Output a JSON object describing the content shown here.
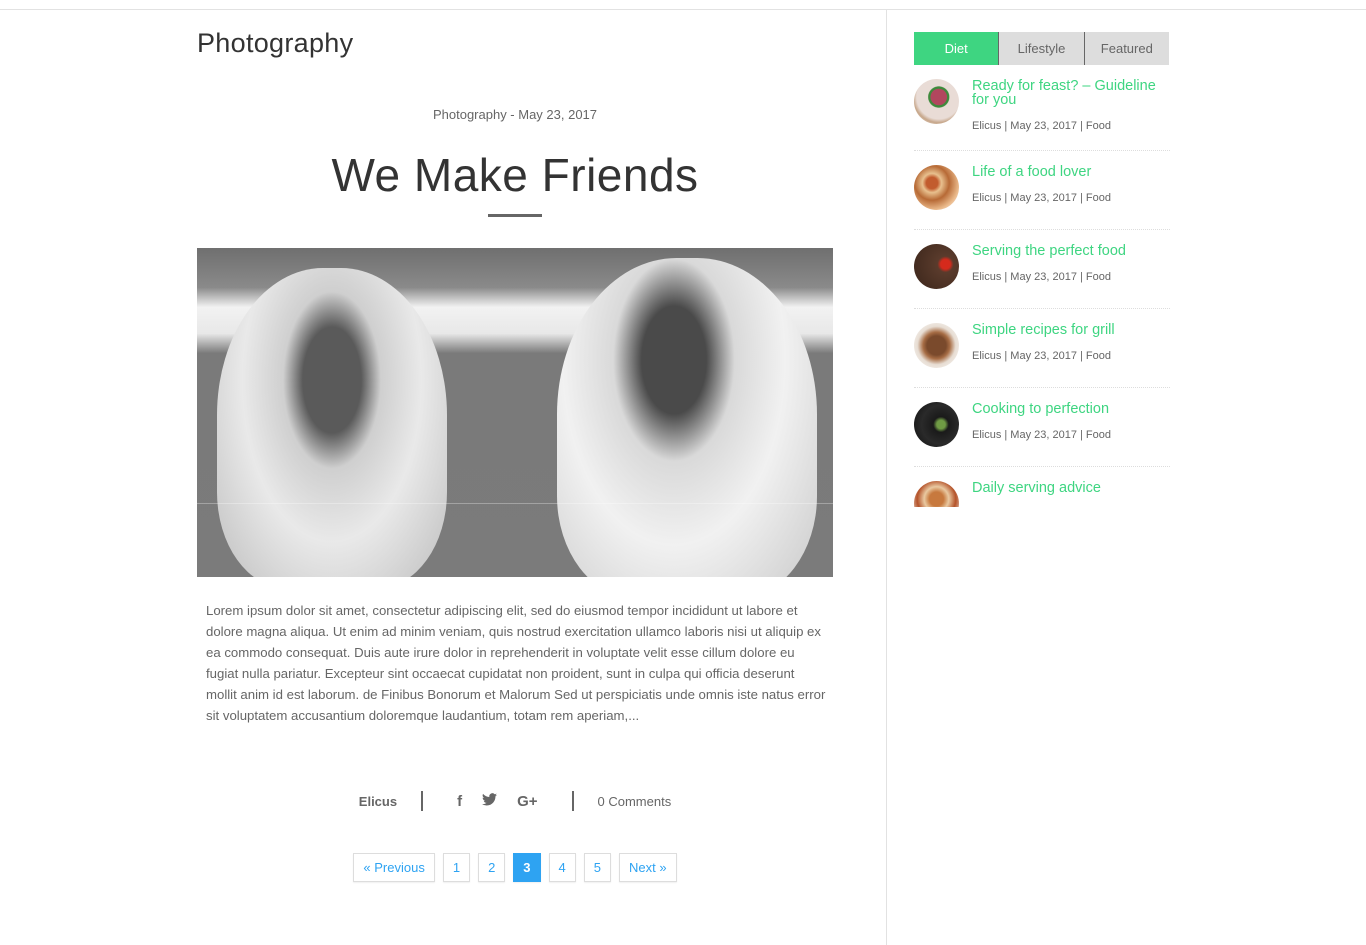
{
  "page": {
    "category_title": "Photography"
  },
  "post": {
    "meta": "Photography - May 23, 2017",
    "title": "We Make Friends",
    "image_alt": "Two pugs sitting side by side (black and white photo)",
    "excerpt": "Lorem ipsum dolor sit amet, consectetur adipiscing elit, sed do eiusmod tempor incididunt ut labore et dolore magna aliqua. Ut enim ad minim veniam, quis nostrud exercitation ullamco laboris nisi ut aliquip ex ea commodo consequat. Duis aute irure dolor in reprehenderit in voluptate velit esse cillum dolore eu fugiat nulla pariatur. Excepteur sint occaecat cupidatat non proident, sunt in culpa qui officia deserunt mollit anim id est laborum. de Finibus Bonorum et Malorum Sed ut perspiciatis unde omnis iste natus error sit voluptatem accusantium doloremque laudantium, totam rem aperiam,...",
    "author": "Elicus",
    "share": {
      "facebook_icon": "f",
      "twitter_icon": "🐦",
      "googleplus_icon": "G+"
    },
    "comments": "0 Comments"
  },
  "pagination": {
    "previous": "« Previous",
    "pages": [
      "1",
      "2",
      "3",
      "4",
      "5"
    ],
    "current": "3",
    "next": "Next »"
  },
  "sidebar": {
    "tabs": [
      {
        "label": "Diet",
        "active": true
      },
      {
        "label": "Lifestyle",
        "active": false
      },
      {
        "label": "Featured",
        "active": false
      }
    ],
    "posts": [
      {
        "title": "Ready for feast? – Guideline for you",
        "meta": "Elicus | May 23, 2017 | Food"
      },
      {
        "title": "Life of a food lover",
        "meta": "Elicus | May 23, 2017 | Food"
      },
      {
        "title": "Serving the perfect food",
        "meta": "Elicus | May 23, 2017 | Food"
      },
      {
        "title": "Simple recipes for grill",
        "meta": "Elicus | May 23, 2017 | Food"
      },
      {
        "title": "Cooking to perfection",
        "meta": "Elicus | May 23, 2017 | Food"
      },
      {
        "title": "Daily serving advice",
        "meta": ""
      }
    ]
  },
  "colors": {
    "accent_green": "#3ed581",
    "link_blue": "#2ea3f2",
    "tab_inactive": "#dddddd"
  }
}
